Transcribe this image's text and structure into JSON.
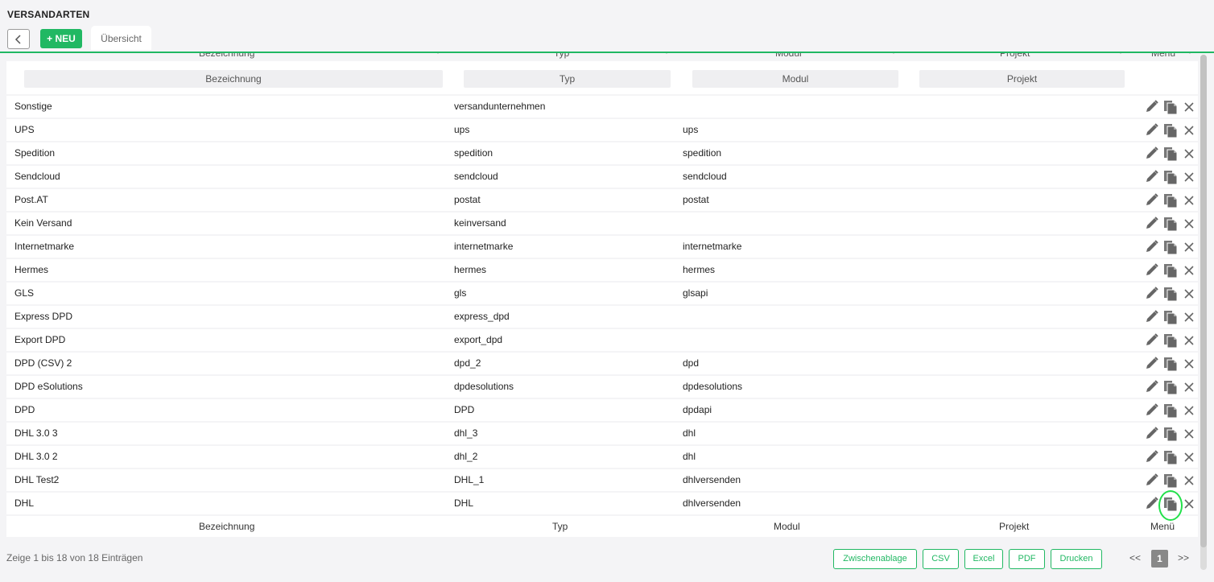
{
  "header": {
    "title": "VERSANDARTEN",
    "new_label": "+ NEU",
    "tab_label": "Übersicht"
  },
  "table": {
    "columns": [
      "Bezeichnung",
      "Typ",
      "Modul",
      "Projekt",
      "Menü"
    ],
    "filter_placeholders": [
      "Bezeichnung",
      "Typ",
      "Modul",
      "Projekt"
    ],
    "rows": [
      {
        "bezeichnung": "Sonstige",
        "typ": "versandunternehmen",
        "modul": ""
      },
      {
        "bezeichnung": "UPS",
        "typ": "ups",
        "modul": "ups"
      },
      {
        "bezeichnung": "Spedition",
        "typ": "spedition",
        "modul": "spedition"
      },
      {
        "bezeichnung": "Sendcloud",
        "typ": "sendcloud",
        "modul": "sendcloud"
      },
      {
        "bezeichnung": "Post.AT",
        "typ": "postat",
        "modul": "postat"
      },
      {
        "bezeichnung": "Kein Versand",
        "typ": "keinversand",
        "modul": ""
      },
      {
        "bezeichnung": "Internetmarke",
        "typ": "internetmarke",
        "modul": "internetmarke"
      },
      {
        "bezeichnung": "Hermes",
        "typ": "hermes",
        "modul": "hermes"
      },
      {
        "bezeichnung": "GLS",
        "typ": "gls",
        "modul": "glsapi"
      },
      {
        "bezeichnung": "Express DPD",
        "typ": "express_dpd",
        "modul": ""
      },
      {
        "bezeichnung": "Export DPD",
        "typ": "export_dpd",
        "modul": ""
      },
      {
        "bezeichnung": "DPD (CSV) 2",
        "typ": "dpd_2",
        "modul": "dpd"
      },
      {
        "bezeichnung": "DPD eSolutions",
        "typ": "dpdesolutions",
        "modul": "dpdesolutions"
      },
      {
        "bezeichnung": "DPD",
        "typ": "DPD",
        "modul": "dpdapi"
      },
      {
        "bezeichnung": "DHL 3.0 3",
        "typ": "dhl_3",
        "modul": "dhl"
      },
      {
        "bezeichnung": "DHL 3.0 2",
        "typ": "dhl_2",
        "modul": "dhl"
      },
      {
        "bezeichnung": "DHL Test2",
        "typ": "DHL_1",
        "modul": "dhlversenden"
      },
      {
        "bezeichnung": "DHL",
        "typ": "DHL",
        "modul": "dhlversenden"
      }
    ]
  },
  "footer": {
    "info": "Zeige 1 bis 18 von 18 Einträgen",
    "export_buttons": [
      "Zwischenablage",
      "CSV",
      "Excel",
      "PDF",
      "Drucken"
    ],
    "pagination": {
      "prev": "<<",
      "current": "1",
      "next": ">>"
    }
  },
  "colors": {
    "accent": "#21b863",
    "highlight": "#22e04a"
  },
  "icons": {
    "edit": "pencil-icon",
    "copy": "copy-icon",
    "delete": "close-icon",
    "back": "chevron-left-icon"
  }
}
